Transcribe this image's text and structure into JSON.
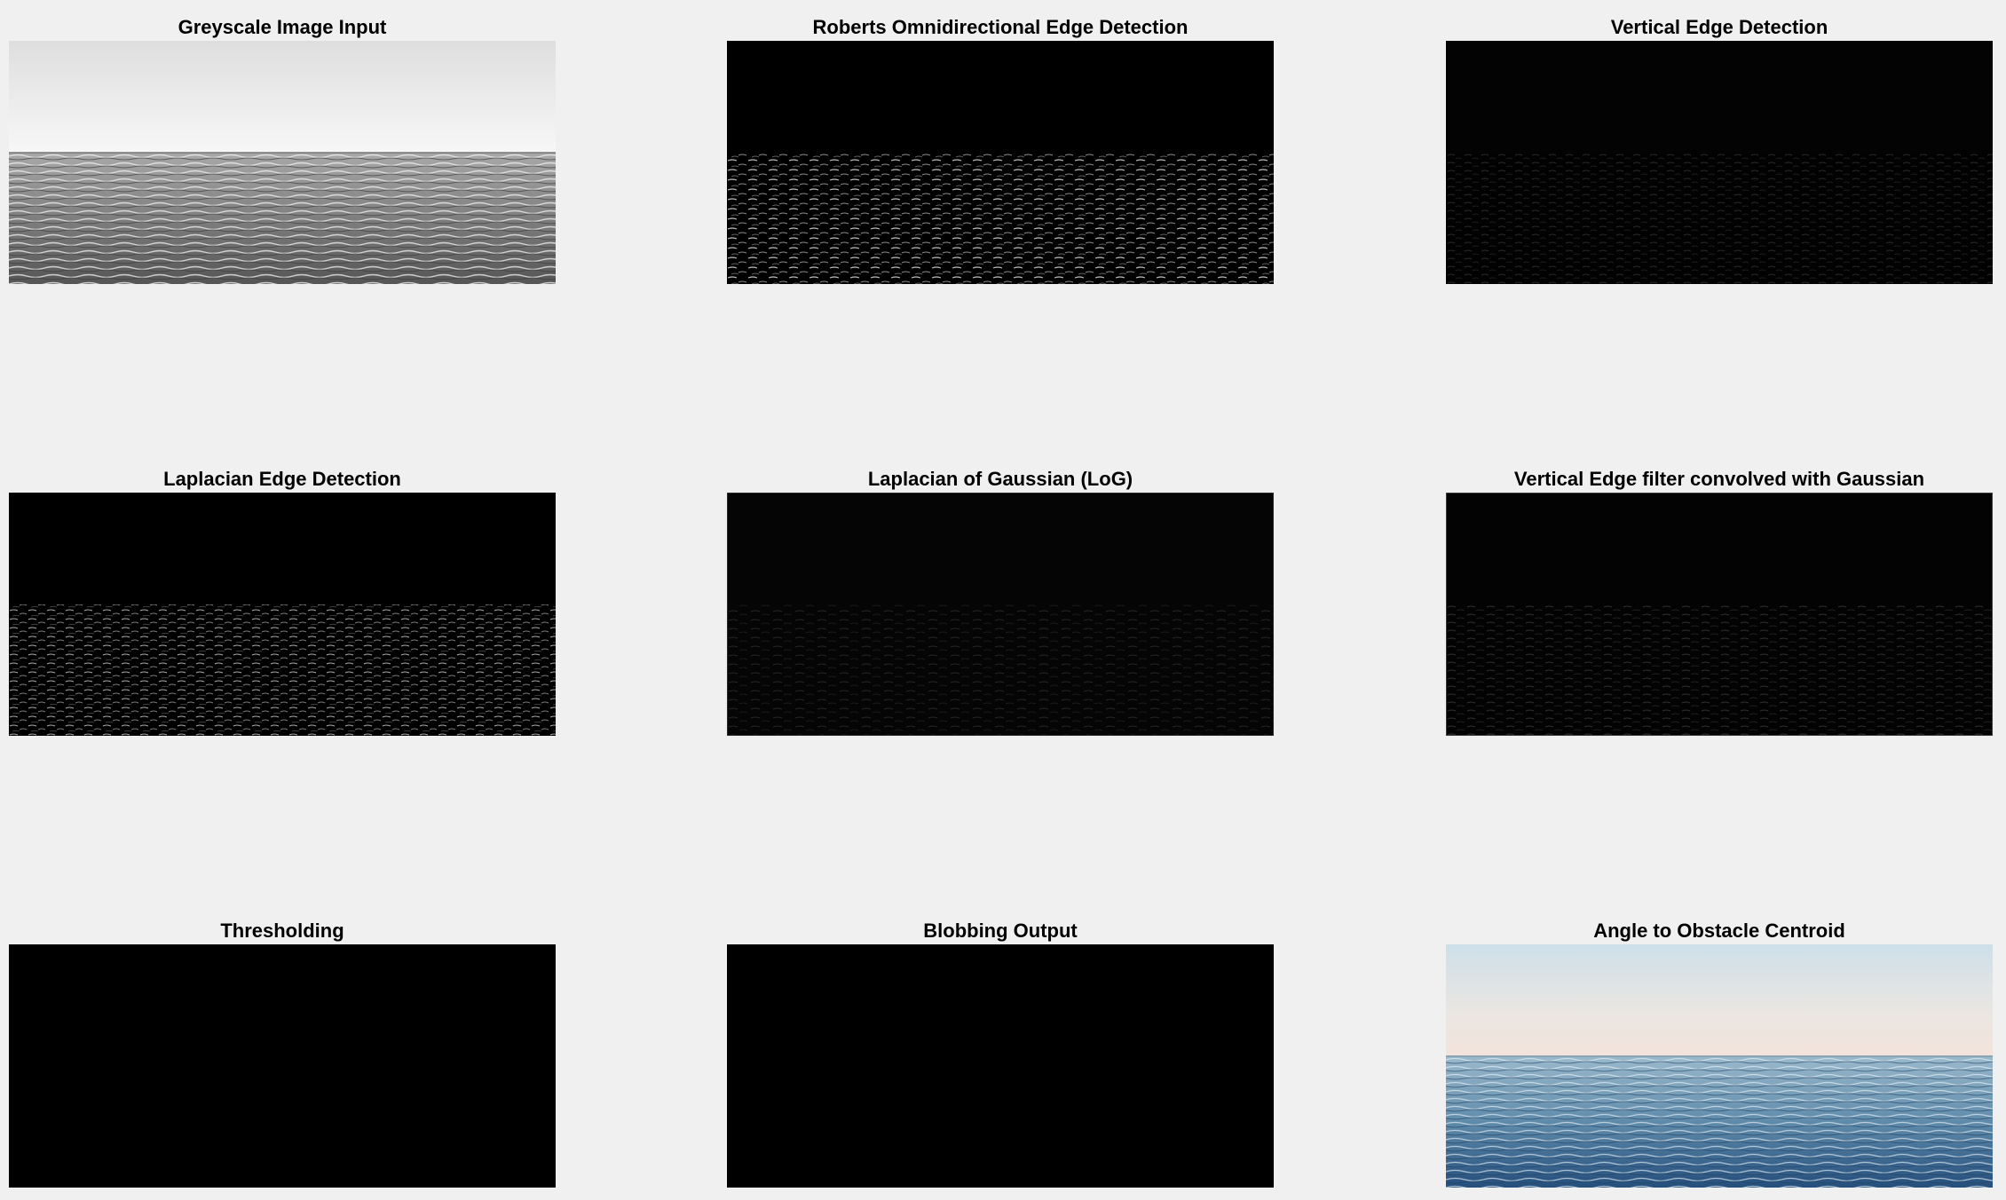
{
  "window": {
    "background": "#f0f0f0"
  },
  "panels": [
    {
      "title": "Greyscale Image Input",
      "image": "greyscale-sea"
    },
    {
      "title": "Roberts Omnidirectional Edge Detection",
      "image": "edges-bright"
    },
    {
      "title": "Vertical Edge Detection",
      "image": "edges-faint"
    },
    {
      "title": "Laplacian Edge Detection",
      "image": "edges-bright"
    },
    {
      "title": "Laplacian of Gaussian (LoG)",
      "image": "edges-faint"
    },
    {
      "title": "Vertical Edge filter convolved with Gaussian",
      "image": "edges-faint"
    },
    {
      "title": "Thresholding",
      "image": "black"
    },
    {
      "title": "Blobbing Output",
      "image": "black"
    },
    {
      "title": "Angle to Obstacle Centroid",
      "image": "color-sea"
    }
  ],
  "colors": {
    "title_text": "#000000",
    "black_image": "#000000",
    "sky_grey_top": "#e2e2e2",
    "sky_grey_bottom": "#f6f6f6",
    "sky_color_top": "#cfe0ea",
    "sky_color_bottom": "#f4e4dc",
    "sea_color_top": "#8fb3c9",
    "sea_color_bottom": "#2c5a86"
  }
}
